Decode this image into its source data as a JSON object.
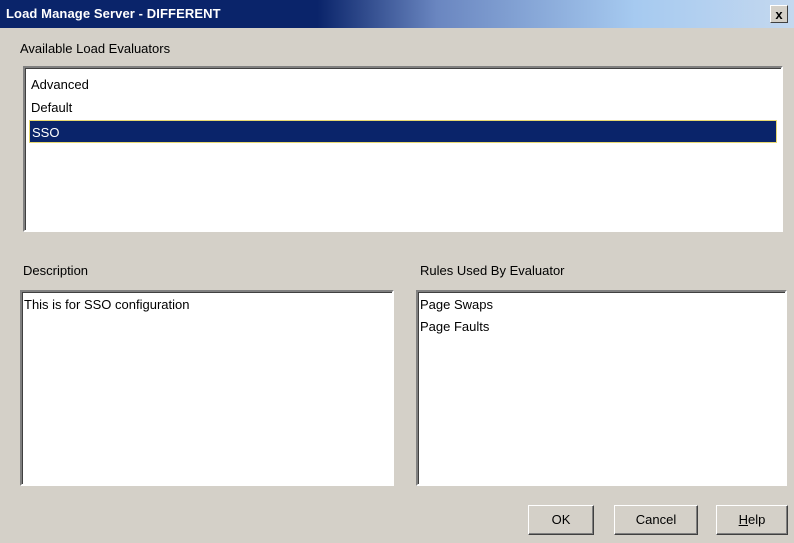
{
  "window": {
    "title": "Load Manage Server - DIFFERENT",
    "close_label": "x"
  },
  "evaluators": {
    "label": "Available Load Evaluators",
    "items": [
      "Advanced",
      "Default",
      "SSO"
    ],
    "selected": "SSO"
  },
  "description": {
    "label": "Description",
    "text": "This is for SSO configuration"
  },
  "rules": {
    "label": "Rules Used By Evaluator",
    "items": [
      "Page Swaps",
      "Page Faults"
    ]
  },
  "buttons": {
    "ok": "OK",
    "cancel": "Cancel",
    "help_mnemonic": "H",
    "help_rest": "elp"
  },
  "colors": {
    "selection": "#0a246a",
    "titlebar": "#0a246a",
    "dialog": "#d4d0c8"
  }
}
